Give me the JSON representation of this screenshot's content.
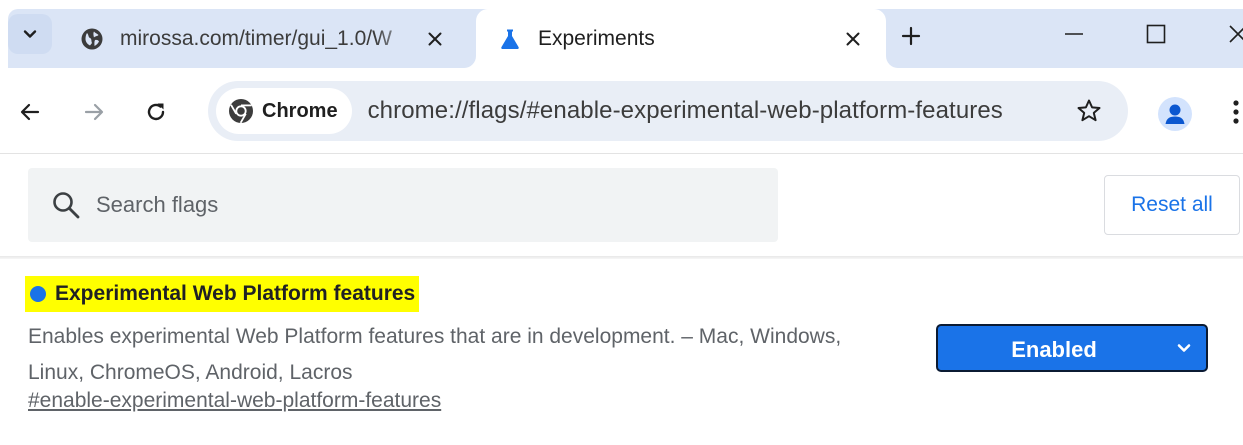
{
  "tabs": [
    {
      "title": "mirossa.com/timer/gui_1.0/W",
      "active": false,
      "favicon": "globe-icon"
    },
    {
      "title": "Experiments",
      "active": true,
      "favicon": "flask-icon"
    }
  ],
  "toolbar": {
    "site_chip_label": "Chrome",
    "url": "chrome://flags/#enable-experimental-web-platform-features"
  },
  "search": {
    "placeholder": "Search flags",
    "value": ""
  },
  "reset_all_label": "Reset all",
  "flag": {
    "name": "Experimental Web Platform features",
    "description": "Enables experimental Web Platform features that are in development. – Mac, Windows, Linux, ChromeOS, Android, Lacros",
    "permalink": "#enable-experimental-web-platform-features",
    "state": "Enabled"
  },
  "colors": {
    "accent": "#1a73e8",
    "highlight": "#ffff00",
    "tabstrip": "#dbe5f6",
    "omnibox": "#e9eef6"
  }
}
